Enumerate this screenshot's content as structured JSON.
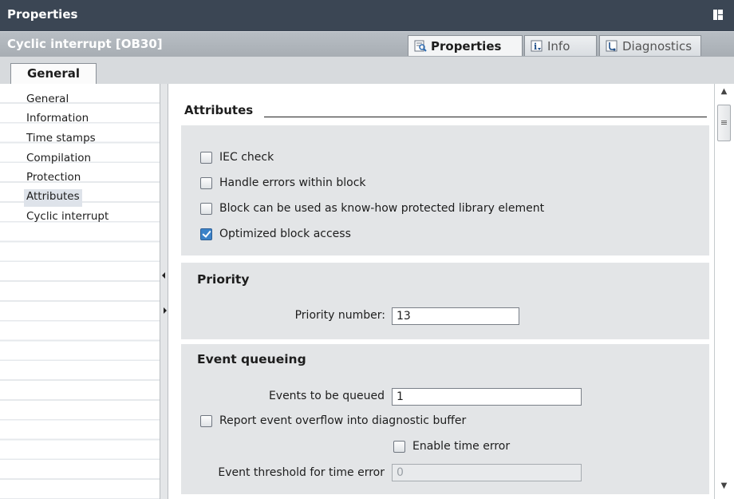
{
  "window": {
    "title": "Properties"
  },
  "object": {
    "title": "Cyclic interrupt [OB30]"
  },
  "tabs": [
    {
      "label": "Properties",
      "icon": "properties-icon"
    },
    {
      "label": "Info",
      "icon": "info-icon"
    },
    {
      "label": "Diagnostics",
      "icon": "diagnostics-icon"
    }
  ],
  "general_tab": "General",
  "nav": {
    "items": [
      "General",
      "Information",
      "Time stamps",
      "Compilation",
      "Protection",
      "Attributes",
      "Cyclic interrupt"
    ],
    "selected": "Attributes"
  },
  "attributes": {
    "heading": "Attributes",
    "checkboxes": [
      {
        "label": "IEC check",
        "checked": false
      },
      {
        "label": "Handle errors within block",
        "checked": false
      },
      {
        "label": "Block can be used as know-how protected library element",
        "checked": false
      },
      {
        "label": "Optimized block access",
        "checked": true
      }
    ]
  },
  "priority": {
    "title": "Priority",
    "label": "Priority number:",
    "value": "13"
  },
  "event_queueing": {
    "title": "Event queueing",
    "events_label": "Events to be queued",
    "events_value": "1",
    "report_label": "Report event overflow into diagnostic buffer",
    "report_checked": false,
    "enable_label": "Enable time error",
    "enable_checked": false,
    "threshold_label": "Event threshold for time error",
    "threshold_value": "0"
  },
  "colors": {
    "title_bar": "#3b4654",
    "object_bar": "#aeb4ba",
    "check_accent": "#3b82c8"
  }
}
